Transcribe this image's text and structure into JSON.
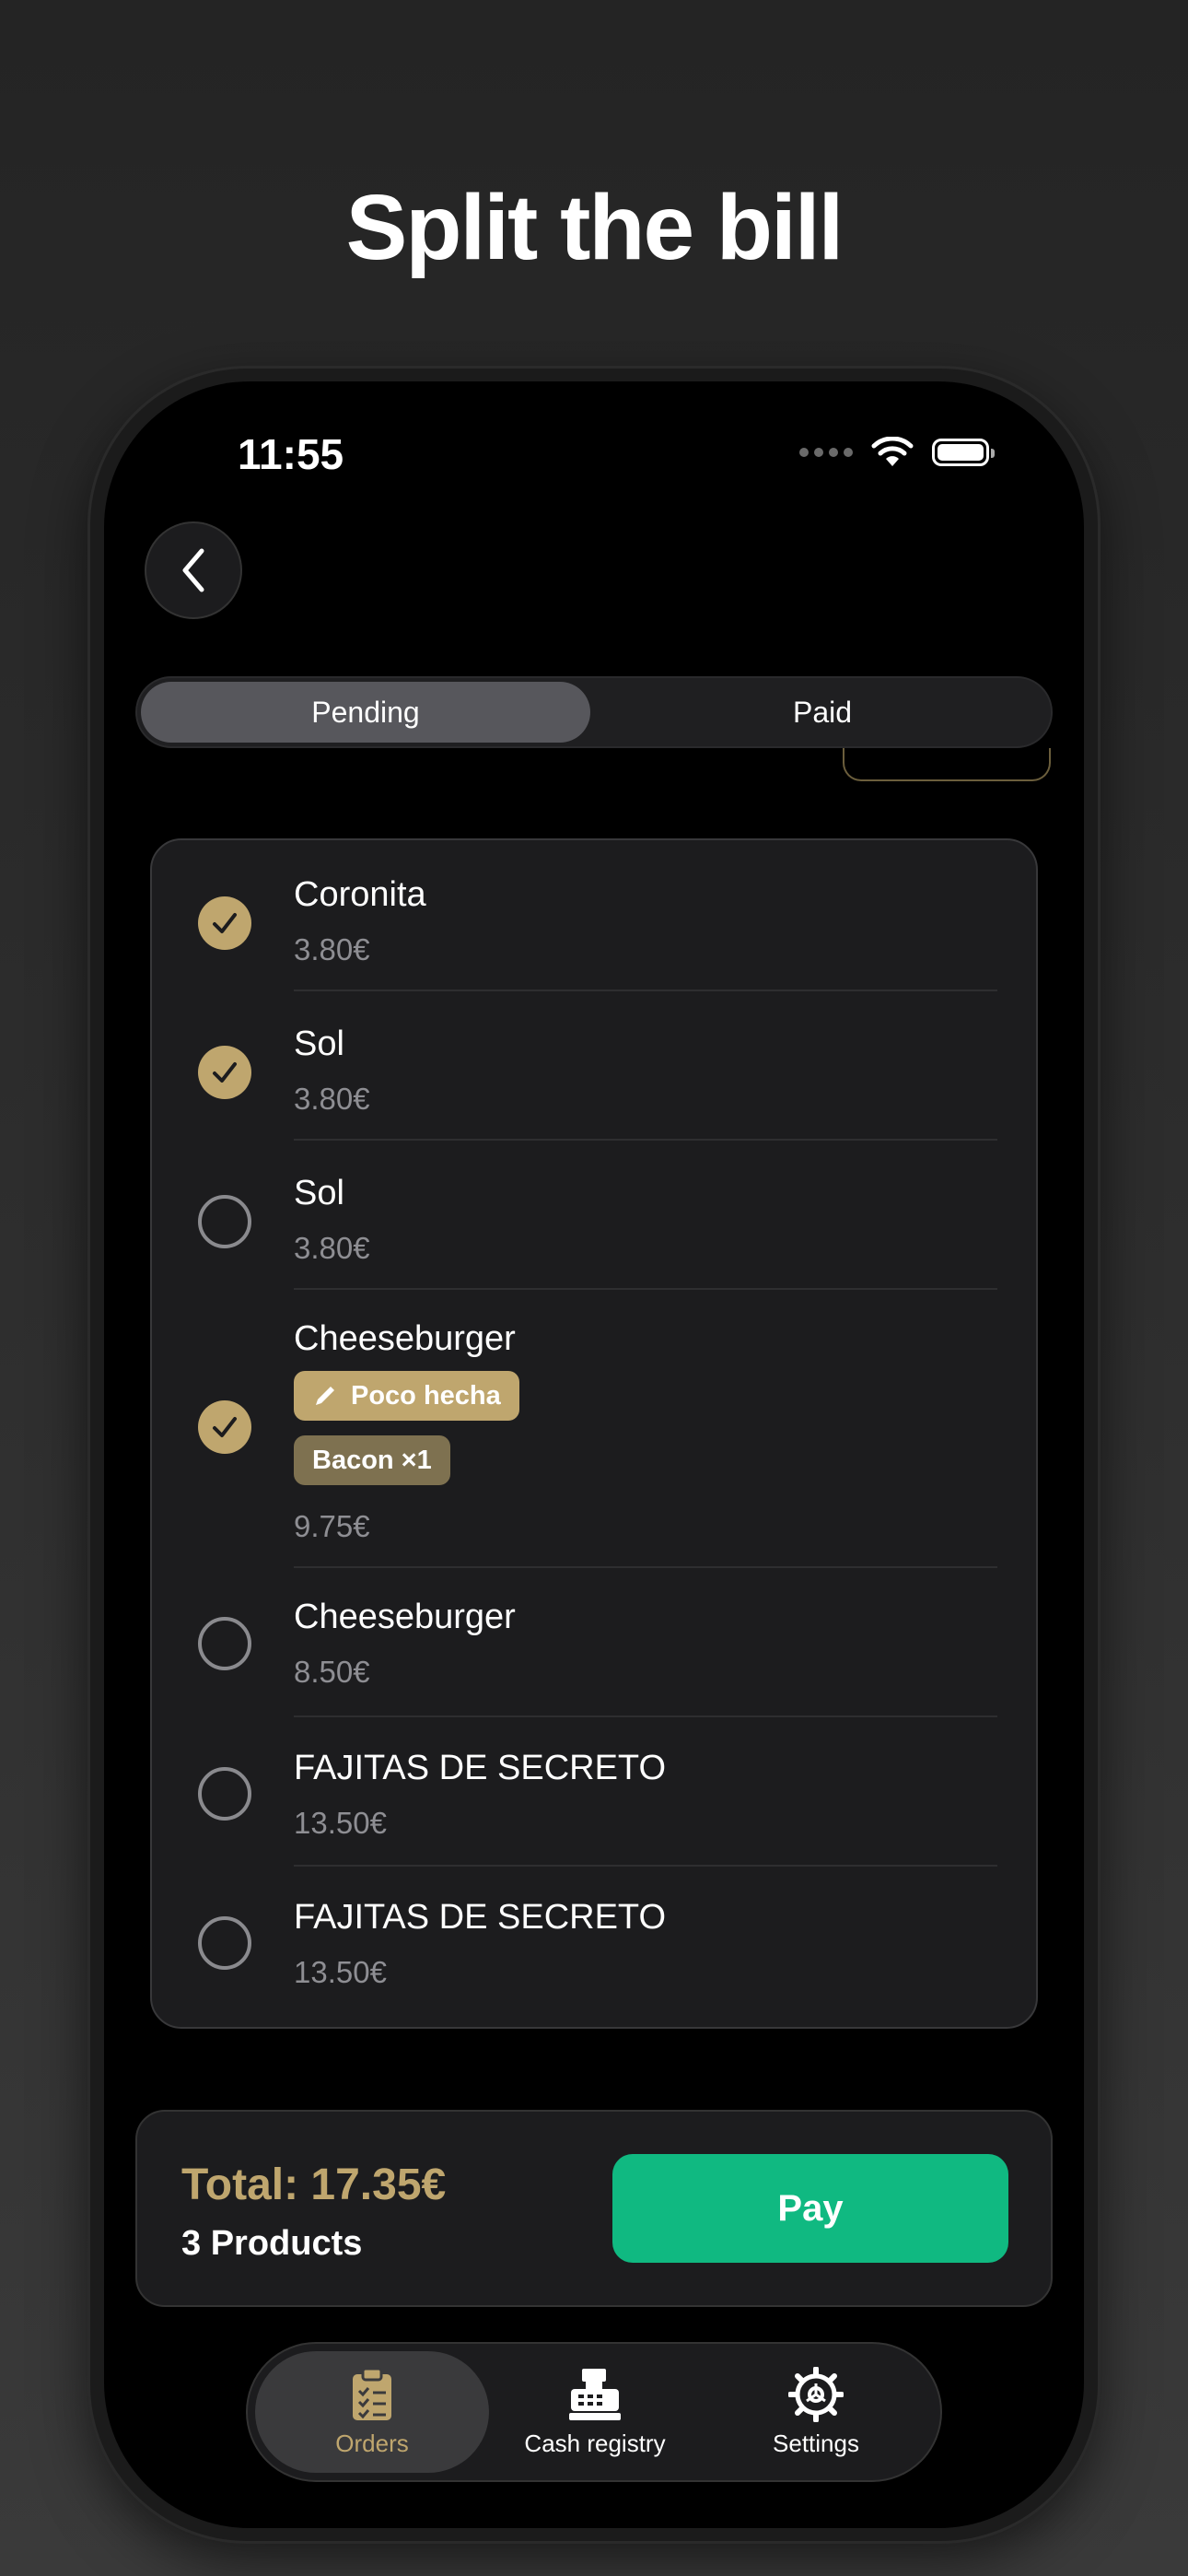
{
  "headline": "Split the bill",
  "status": {
    "time": "11:55"
  },
  "tabs": {
    "pending": "Pending",
    "paid": "Paid"
  },
  "items": [
    {
      "name": "Coronita",
      "price": "3.80€",
      "checked": true
    },
    {
      "name": "Sol",
      "price": "3.80€",
      "checked": true
    },
    {
      "name": "Sol",
      "price": "3.80€",
      "checked": false
    },
    {
      "name": "Cheeseburger",
      "price": "9.75€",
      "checked": true,
      "note": "Poco hecha",
      "extra": "Bacon ×1"
    },
    {
      "name": "Cheeseburger",
      "price": "8.50€",
      "checked": false
    },
    {
      "name": "FAJITAS DE SECRETO",
      "price": "13.50€",
      "checked": false
    },
    {
      "name": "FAJITAS DE SECRETO",
      "price": "13.50€",
      "checked": false
    }
  ],
  "footer": {
    "total": "Total: 17.35€",
    "count": "3 Products",
    "pay_label": "Pay"
  },
  "nav": [
    {
      "label": "Orders",
      "icon": "clipboard-icon",
      "active": true
    },
    {
      "label": "Cash registry",
      "icon": "cash-register-icon",
      "active": false
    },
    {
      "label": "Settings",
      "icon": "gear-icon",
      "active": false
    }
  ],
  "colors": {
    "accent": "#bfa66e",
    "pay": "#10b981",
    "background": "#000000"
  }
}
